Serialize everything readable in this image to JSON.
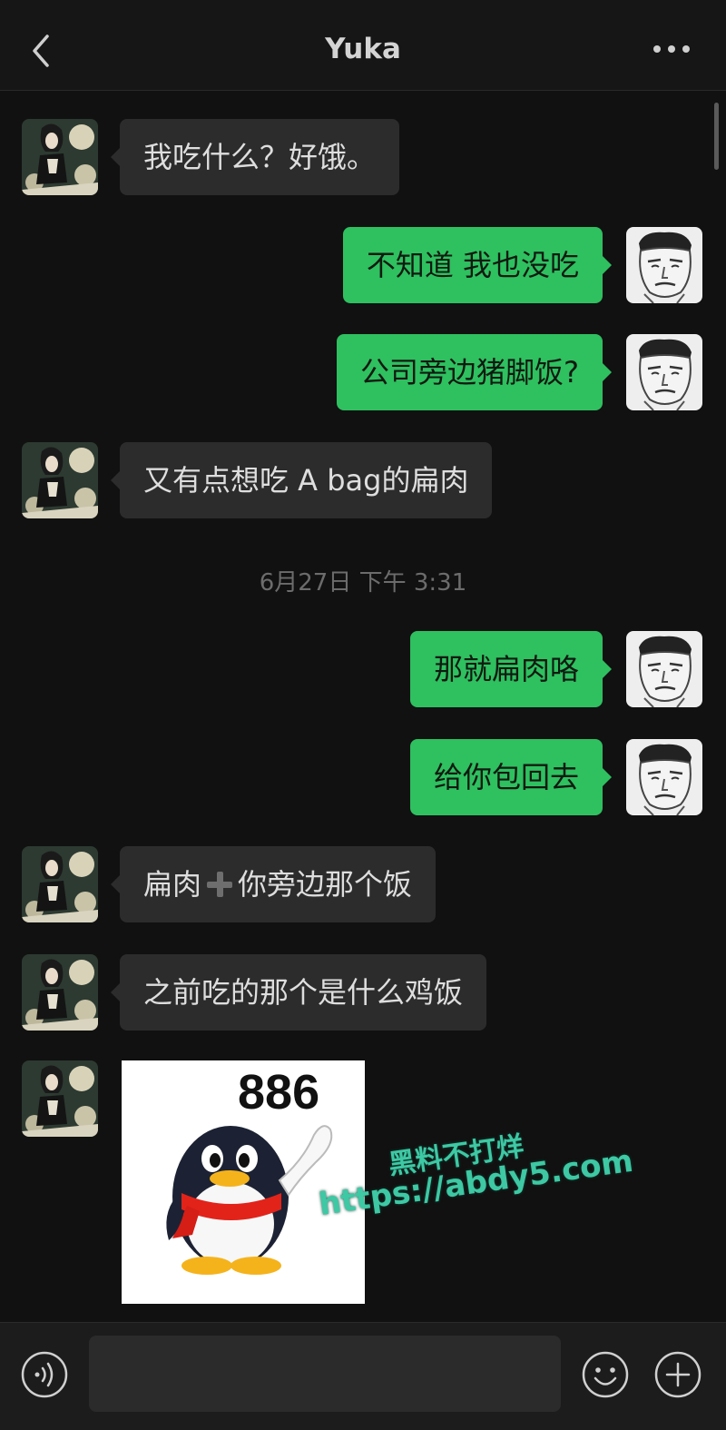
{
  "header": {
    "title": "Yuka",
    "back_icon": "chevron-left-icon",
    "more_icon": "more-dots-icon"
  },
  "messages": [
    {
      "direction": "in",
      "text": "我吃什么？好饿。"
    },
    {
      "direction": "out",
      "text": "不知道 我也没吃"
    },
    {
      "direction": "out",
      "text": "公司旁边猪脚饭?"
    },
    {
      "direction": "in",
      "text": "又有点想吃 A bag的扁肉"
    },
    {
      "timestamp": "6月27日 下午 3:31"
    },
    {
      "direction": "out",
      "text": "那就扁肉咯"
    },
    {
      "direction": "out",
      "text": "给你包回去"
    },
    {
      "direction": "in",
      "text_before": "扁肉",
      "emoji": "heavy-plus-sign",
      "text_after": "你旁边那个饭"
    },
    {
      "direction": "in",
      "text": "之前吃的那个是什么鸡饭"
    },
    {
      "direction": "in",
      "sticker": {
        "caption": "886",
        "icon": "penguin-waving-sticker"
      }
    }
  ],
  "watermark": {
    "line1": "黑料不打烊",
    "line2": "https://abdy5.com"
  },
  "input_bar": {
    "voice_icon": "voice-icon",
    "emoji_icon": "emoji-icon",
    "add_icon": "add-icon",
    "input_value": ""
  },
  "colors": {
    "background": "#111111",
    "incoming_bubble": "#2c2c2c",
    "outgoing_bubble": "#2fc060",
    "watermark": "#3ec8a4"
  }
}
